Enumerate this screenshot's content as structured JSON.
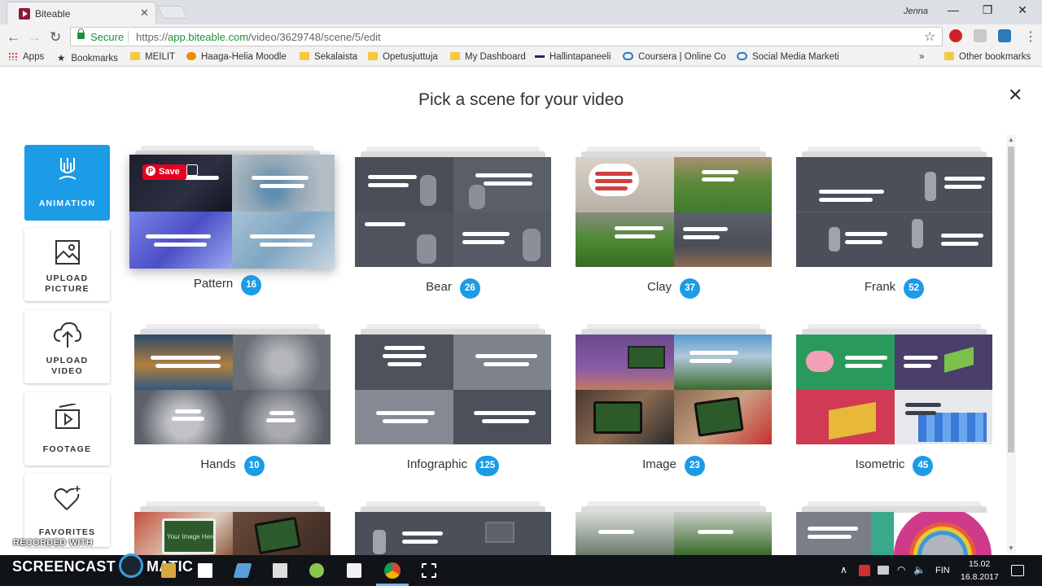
{
  "browser": {
    "tab_title": "Biteable",
    "tab_close": "✕",
    "user": "Jenna",
    "window_controls": {
      "minimize": "—",
      "maximize": "❐",
      "close": "✕"
    },
    "nav": {
      "back": "←",
      "forward": "→",
      "reload": "↻"
    },
    "secure_label": "Secure",
    "url_scheme": "https://",
    "url_host": "app.biteable.com",
    "url_path": "/video/3629748/scene/5/edit",
    "star": "☆",
    "menu": "⋮",
    "bookmarks": {
      "apps": "Apps",
      "items": [
        "Bookmarks",
        "MEILIT",
        "Haaga-Helia Moodle",
        "Sekalaista",
        "Opetusjuttuja",
        "My Dashboard",
        "Hallintapaneeli",
        "Coursera | Online Co",
        "Social Media Marketi"
      ],
      "more": "»",
      "other": "Other bookmarks"
    }
  },
  "page": {
    "title": "Pick a scene for your video",
    "close": "✕"
  },
  "sidebar": [
    {
      "label_line1": "ANIMATION",
      "label_line2": "",
      "icon": "brush-icon",
      "active": true
    },
    {
      "label_line1": "UPLOAD",
      "label_line2": "PICTURE",
      "icon": "picture-icon",
      "active": false
    },
    {
      "label_line1": "UPLOAD",
      "label_line2": "VIDEO",
      "icon": "cloud-upload-icon",
      "active": false
    },
    {
      "label_line1": "FOOTAGE",
      "label_line2": "",
      "icon": "video-icon",
      "active": false
    },
    {
      "label_line1": "FAVORITES",
      "label_line2": "",
      "icon": "heart-icon",
      "active": false
    }
  ],
  "scenes": [
    {
      "name": "Pattern",
      "count": "16"
    },
    {
      "name": "Bear",
      "count": "26"
    },
    {
      "name": "Clay",
      "count": "37"
    },
    {
      "name": "Frank",
      "count": "52"
    },
    {
      "name": "Hands",
      "count": "10"
    },
    {
      "name": "Infographic",
      "count": "125"
    },
    {
      "name": "Image",
      "count": "23"
    },
    {
      "name": "Isometric",
      "count": "45"
    }
  ],
  "pinterest_save": "Save",
  "thumb_overlay_text": "Your Image Here",
  "watermark": {
    "line1": "RECORDED WITH",
    "brand_left": "SCREENCAST",
    "brand_right": "MATIC"
  },
  "taskbar": {
    "lang": "FIN",
    "time": "15.02",
    "date": "16.8.2017",
    "tray_up": "∧",
    "wifi": "◠",
    "volume": "🔈"
  },
  "colors": {
    "accent": "#1c9be6",
    "pinterest": "#e60023",
    "secure": "#1e8e3e"
  }
}
